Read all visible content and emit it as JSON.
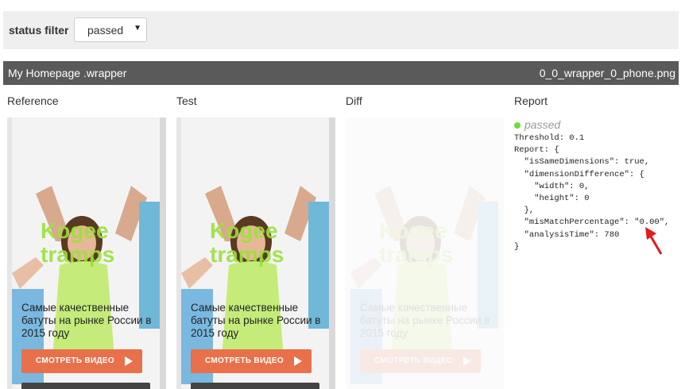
{
  "filter": {
    "label": "status filter",
    "selected": "passed"
  },
  "test": {
    "name": "My Homepage .wrapper",
    "file": "0_0_wrapper_0_phone.png"
  },
  "columns": {
    "reference": "Reference",
    "test": "Test",
    "diff": "Diff",
    "report": "Report"
  },
  "screenshot": {
    "brand_line1": "Kogee",
    "brand_line2": "tramps",
    "caption": "Самые качественные батуты на рынке России в 2015 году",
    "cta": "СМОТРЕТЬ ВИДЕО"
  },
  "report": {
    "status": "passed",
    "status_color": "#6adf2f",
    "lines": [
      "Threshold: 0.1",
      "Report: {",
      "  \"isSameDimensions\": true,",
      "  \"dimensionDifference\": {",
      "    \"width\": 0,",
      "    \"height\": 0",
      "  },",
      "  \"misMatchPercentage\": \"0.00\",",
      "  \"analysisTime\": 780",
      "}"
    ]
  },
  "colors": {
    "accent": "#e8704a",
    "header": "#5a5a5a",
    "brand": "#9be23a",
    "arrow": "#e31b1b"
  }
}
